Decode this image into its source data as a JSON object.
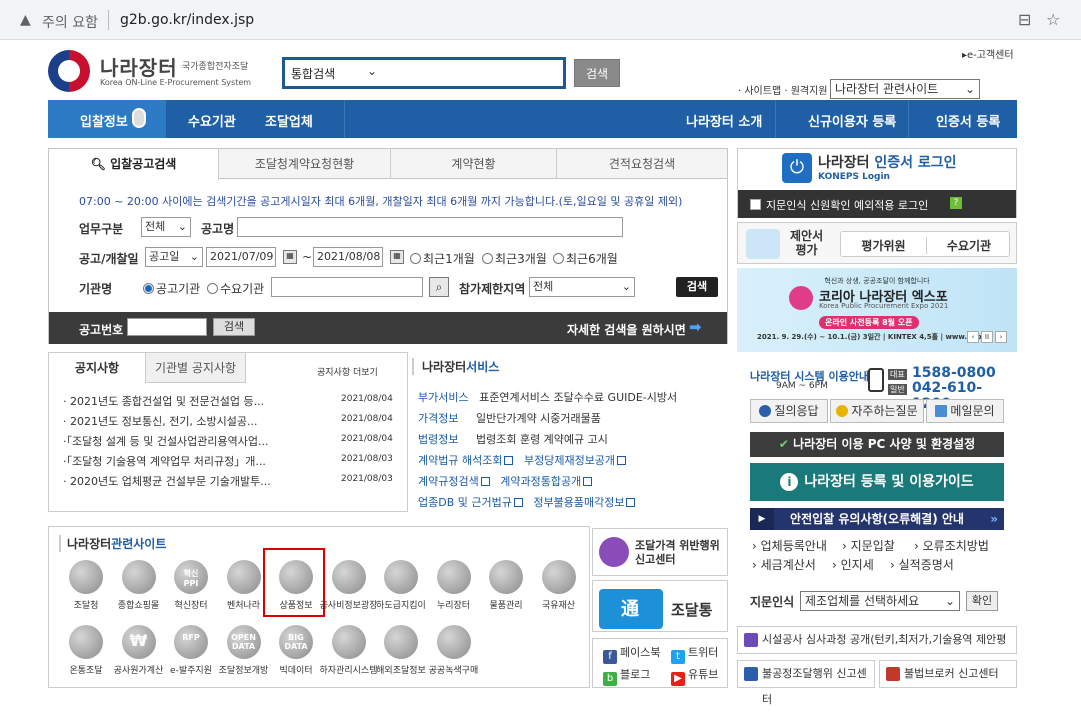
{
  "browser": {
    "insecure": "주의 요함",
    "url": "g2b.go.kr/index.jsp"
  },
  "logo": {
    "ko": "나라장터",
    "ko_sub": "국가종합전자조달",
    "en": "Korea ON-Line E-Procurement System"
  },
  "search": {
    "select": "통합검색",
    "button": "검색"
  },
  "header": {
    "customer_center": "▸e-고객센터",
    "sitemap": "· 사이트맵 · 원격지원",
    "related_select": "나라장터 관련사이트"
  },
  "gnb": {
    "items": [
      "입찰정보",
      "수요기관",
      "조달업체",
      "나라장터 소개",
      "신규이용자 등록",
      "인증서 등록"
    ]
  },
  "search_panel": {
    "tabs": [
      "입찰공고검색",
      "조달청계약요청현황",
      "계약현황",
      "견적요청검색"
    ],
    "notice": "07:00 ~ 20:00 사이에는 검색기간을 공고게시일자 최대 6개월, 개찰일자 최대 6개월 까지 가능합니다.(토,일요일 및 공휴일 제외)",
    "label_type": "업무구분",
    "type_value": "전체",
    "label_name": "공고명",
    "label_date": "공고/개찰일",
    "date_kind": "공고일",
    "date_from": "2021/07/09",
    "tilde": "~",
    "date_to": "2021/08/08",
    "ranges": [
      "최근1개월",
      "최근3개월",
      "최근6개월"
    ],
    "label_org": "기관명",
    "org_options": [
      "공고기관",
      "수요기관"
    ],
    "label_region": "참가제한지역",
    "region_value": "전체",
    "submit": "검색",
    "bar_label": "공고번호",
    "bar_button": "검색",
    "bar_right": "자세한 검색을 원하시면"
  },
  "notices": {
    "tab1": "공지사항",
    "tab2": "기관별 공지사항",
    "more": "공지사항 더보기",
    "items": [
      {
        "title": "· 2021년도 종합건설업 및 전문건설업 등...",
        "date": "2021/08/04"
      },
      {
        "title": "· 2021년도 정보통신, 전기, 소방시설공...",
        "date": "2021/08/04"
      },
      {
        "title": "·「조달청 설계 등 및 건설사업관리용역사업...",
        "date": "2021/08/04"
      },
      {
        "title": "·「조달청 기술용역 계약업무 처리규정」개...",
        "date": "2021/08/03"
      },
      {
        "title": "· 2020년도 업체평균 건설부문 기술개발투...",
        "date": "2021/08/03"
      }
    ]
  },
  "services": {
    "title_a": "나라장터",
    "title_b": "서비스",
    "rows": [
      {
        "k": "부가서비스",
        "v": "표준연계서비스  조달수수료  GUIDE-시방서"
      },
      {
        "k": "가격정보",
        "v": "일반단가계약  시중거래물품"
      },
      {
        "k": "법령정보",
        "v": "법령조회    훈령    계약예규    고시"
      }
    ],
    "links": [
      [
        "계약법규 해석조회",
        "부정당제재정보공개"
      ],
      [
        "계약규정검색",
        "계약과정통합공개"
      ],
      [
        "업종DB 및 근거법규",
        "정부불용품매각정보"
      ]
    ]
  },
  "related": {
    "title_a": "나라장터",
    "title_b": "관련사이트",
    "row1": [
      "조달청",
      "종합쇼핑몰",
      "혁신장터",
      "벤처나라",
      "상품정보",
      "공사비정보광장",
      "하도급지킴이",
      "누리장터",
      "물품관리",
      "국유재산"
    ],
    "row2": [
      "온통조달",
      "공사원가계산",
      "e-발주지원",
      "조달정보개방",
      "빅데이터",
      "하자관리시스템",
      "해외조달정보",
      "공공녹색구매"
    ],
    "glyphs": {
      "ppi": "혁신\nPPI",
      "rfp": "RFP",
      "open": "OPEN\nDATA",
      "big": "BIG\nDATA",
      "won": "₩"
    }
  },
  "cards": {
    "violation": "조달가격 위반행위\n신고센터",
    "jodaltong_glyph": "通",
    "jodaltong": "조달통",
    "sns": [
      "페이스북",
      "트위터",
      "블로그",
      "유튜브"
    ]
  },
  "login": {
    "title_a": "나라장터",
    "title_b": " 인증서 로그인",
    "sub": "KONEPS Login",
    "check": "지문인식 신원확인 예외적용 로그인",
    "help": "?"
  },
  "proposal": {
    "title": "제안서\n평가",
    "b1": "평가위원",
    "b2": "수요기관"
  },
  "banner": {
    "top": "혁신과 상생, 공공조달이 함께합니다",
    "title": "코리아 나라장터 엑스포",
    "sub": "Korea Public Procurement Expo 2021",
    "pill": "온라인 사전등록 8월 오픈",
    "bottom": "2021. 9. 29.(수) ~ 10.1.(금) 3일간 | KINTEX 4,5홀 | www.kop",
    "nav": [
      "‹",
      "II",
      "›"
    ]
  },
  "call": {
    "a": "나라장터 시스템 이용안내",
    "b": "9AM ~ 6PM",
    "tag1": "대표",
    "num1": "1588-0800",
    "tag2": "일반",
    "num2": "042-610-1200"
  },
  "quick": [
    "질의응답",
    "자주하는질문",
    "메일문의"
  ],
  "pcspec": "나라장터 이용 PC 사양 및 환경설정",
  "guide": "나라장터 등록 및 이용가이드",
  "safe": "안전입찰 유의사항(오류해결) 안내",
  "quicklinks": [
    "업체등록안내",
    "지문입찰",
    "오류조치방법",
    "세금계산서",
    "인지세",
    "실적증명서"
  ],
  "cert": {
    "label": "지문인식",
    "select": "제조업체를 선택하세요",
    "button": "확인"
  },
  "facility": "시설공사 심사과정 공개(턴키,최저가,기술용역 제안평가)",
  "bottom_btns": [
    "불공정조달행위 신고센터",
    "불법브로커 신고센터"
  ],
  "colors": {
    "brand": "#1e5fa5",
    "highlight": "#dd0000"
  }
}
